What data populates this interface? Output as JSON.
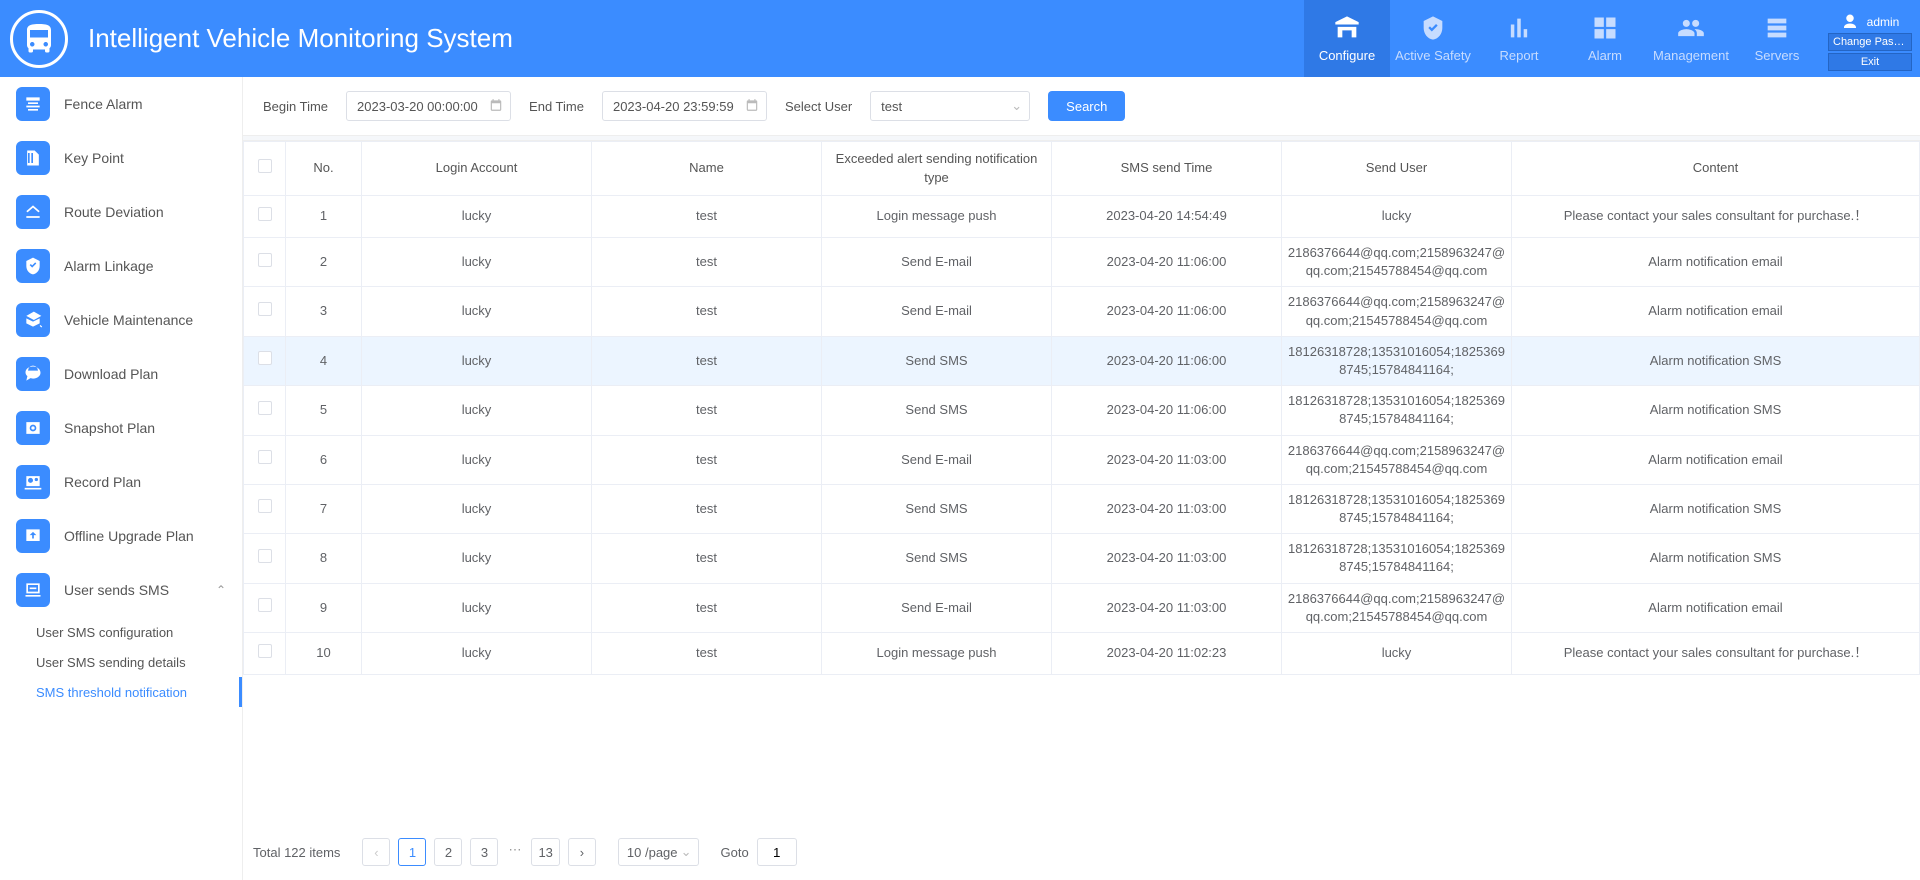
{
  "header": {
    "title": "Intelligent Vehicle Monitoring System",
    "nav": [
      {
        "label": "Configure",
        "active": true
      },
      {
        "label": "Active Safety"
      },
      {
        "label": "Report"
      },
      {
        "label": "Alarm"
      },
      {
        "label": "Management"
      },
      {
        "label": "Servers"
      }
    ],
    "user": "admin",
    "change_pass": "Change Pass...",
    "exit": "Exit"
  },
  "sidebar": {
    "items": [
      {
        "label": "Fence Alarm"
      },
      {
        "label": "Key Point"
      },
      {
        "label": "Route Deviation"
      },
      {
        "label": "Alarm Linkage"
      },
      {
        "label": "Vehicle Maintenance"
      },
      {
        "label": "Download Plan"
      },
      {
        "label": "Snapshot Plan"
      },
      {
        "label": "Record Plan"
      },
      {
        "label": "Offline Upgrade Plan"
      },
      {
        "label": "User sends SMS",
        "expanded": true,
        "children": [
          {
            "label": "User SMS configuration"
          },
          {
            "label": "User SMS sending details"
          },
          {
            "label": "SMS threshold notification",
            "active": true
          }
        ]
      }
    ]
  },
  "filters": {
    "begin_label": "Begin Time",
    "begin_value": "2023-03-20 00:00:00",
    "end_label": "End Time",
    "end_value": "2023-04-20 23:59:59",
    "user_label": "Select User",
    "user_value": "test",
    "search": "Search"
  },
  "table": {
    "headers": [
      "",
      "No.",
      "Login Account",
      "Name",
      "Exceeded alert sending notification type",
      "SMS send Time",
      "Send User",
      "Content"
    ],
    "rows": [
      {
        "no": "1",
        "acc": "lucky",
        "name": "test",
        "type": "Login message push",
        "time": "2023-04-20 14:54:49",
        "user": "lucky",
        "content": "Please contact your sales consultant for purchase.！"
      },
      {
        "no": "2",
        "acc": "lucky",
        "name": "test",
        "type": "Send E-mail",
        "time": "2023-04-20 11:06:00",
        "user": "2186376644@qq.com;2158963247@qq.com;21545788454@qq.com",
        "content": "Alarm notification email"
      },
      {
        "no": "3",
        "acc": "lucky",
        "name": "test",
        "type": "Send E-mail",
        "time": "2023-04-20 11:06:00",
        "user": "2186376644@qq.com;2158963247@qq.com;21545788454@qq.com",
        "content": "Alarm notification email"
      },
      {
        "no": "4",
        "acc": "lucky",
        "name": "test",
        "type": "Send SMS",
        "time": "2023-04-20 11:06:00",
        "user": "18126318728;13531016054;18253698745;15784841164;",
        "content": "Alarm notification SMS",
        "hl": true
      },
      {
        "no": "5",
        "acc": "lucky",
        "name": "test",
        "type": "Send SMS",
        "time": "2023-04-20 11:06:00",
        "user": "18126318728;13531016054;18253698745;15784841164;",
        "content": "Alarm notification SMS"
      },
      {
        "no": "6",
        "acc": "lucky",
        "name": "test",
        "type": "Send E-mail",
        "time": "2023-04-20 11:03:00",
        "user": "2186376644@qq.com;2158963247@qq.com;21545788454@qq.com",
        "content": "Alarm notification email"
      },
      {
        "no": "7",
        "acc": "lucky",
        "name": "test",
        "type": "Send SMS",
        "time": "2023-04-20 11:03:00",
        "user": "18126318728;13531016054;18253698745;15784841164;",
        "content": "Alarm notification SMS"
      },
      {
        "no": "8",
        "acc": "lucky",
        "name": "test",
        "type": "Send SMS",
        "time": "2023-04-20 11:03:00",
        "user": "18126318728;13531016054;18253698745;15784841164;",
        "content": "Alarm notification SMS"
      },
      {
        "no": "9",
        "acc": "lucky",
        "name": "test",
        "type": "Send E-mail",
        "time": "2023-04-20 11:03:00",
        "user": "2186376644@qq.com;2158963247@qq.com;21545788454@qq.com",
        "content": "Alarm notification email"
      },
      {
        "no": "10",
        "acc": "lucky",
        "name": "test",
        "type": "Login message push",
        "time": "2023-04-20 11:02:23",
        "user": "lucky",
        "content": "Please contact your sales consultant for purchase.！"
      }
    ]
  },
  "pager": {
    "total": "Total 122 items",
    "pages": [
      "1",
      "2",
      "3",
      "...",
      "13"
    ],
    "active": "1",
    "per_page": "10 /page",
    "goto_label": "Goto",
    "goto_value": "1"
  }
}
